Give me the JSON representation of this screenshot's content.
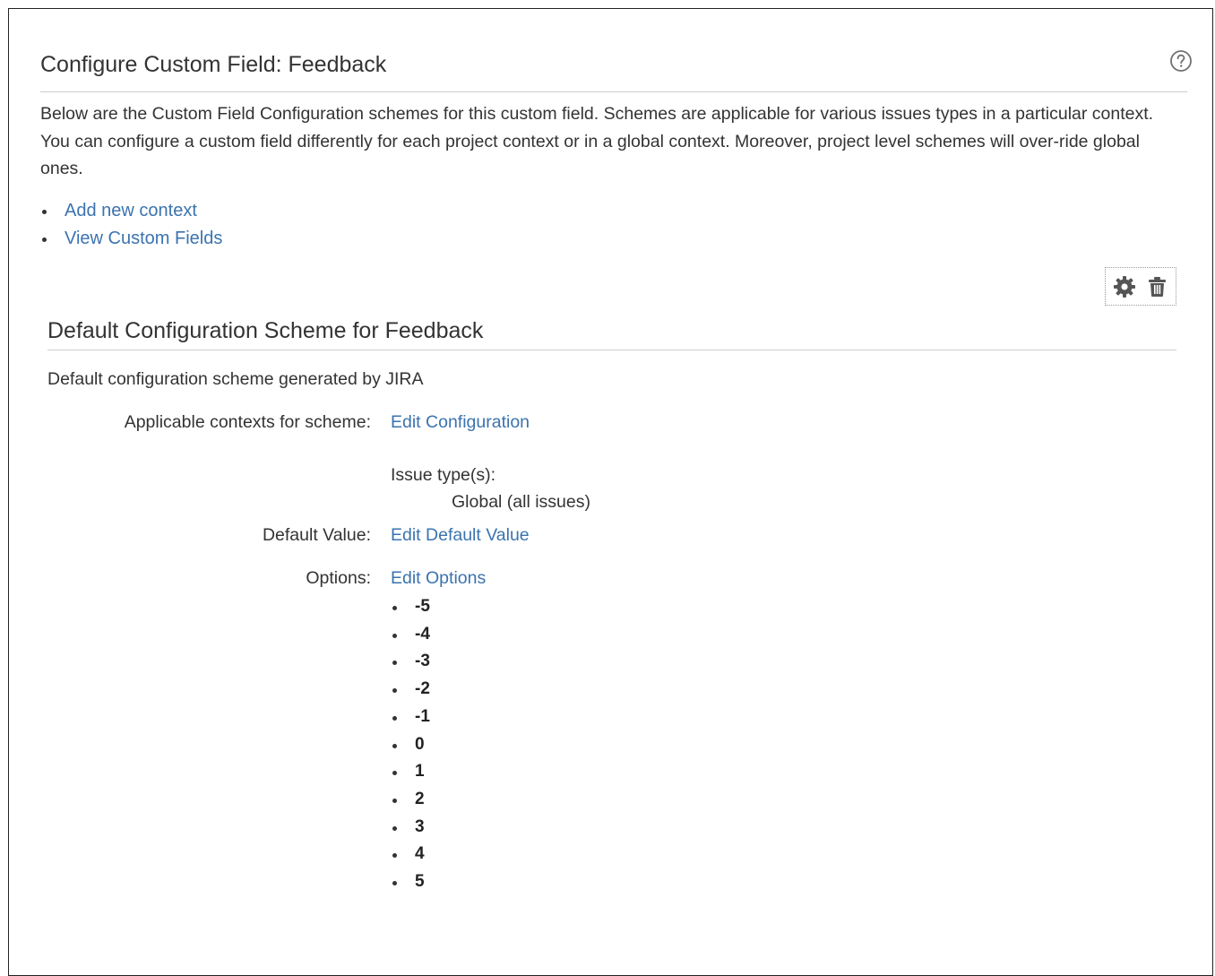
{
  "page": {
    "title": "Configure Custom Field: Feedback",
    "help_icon": "question-circle-icon",
    "description": "Below are the Custom Field Configuration schemes for this custom field. Schemes are applicable for various issues types in a particular context. You can configure a custom field differently for each project context or in a global context. Moreover, project level schemes will over-ride global ones.",
    "links": [
      "Add new context",
      "View Custom Fields"
    ]
  },
  "scheme": {
    "tools": {
      "edit_icon": "gear-icon",
      "delete_icon": "trash-icon"
    },
    "title": "Default Configuration Scheme for Feedback",
    "description": "Default configuration scheme generated by JIRA",
    "contexts_label": "Applicable contexts for scheme:",
    "contexts_link": "Edit Configuration",
    "issue_types_label": "Issue type(s):",
    "issue_types_value": "Global (all issues)",
    "default_value_label": "Default Value:",
    "default_value_link": "Edit Default Value",
    "options_label": "Options:",
    "options_link": "Edit Options",
    "options": [
      "-5",
      "-4",
      "-3",
      "-2",
      "-1",
      "0",
      "1",
      "2",
      "3",
      "4",
      "5"
    ]
  },
  "colors": {
    "link": "#3b73af",
    "text": "#333333",
    "divider": "#cccccc"
  }
}
